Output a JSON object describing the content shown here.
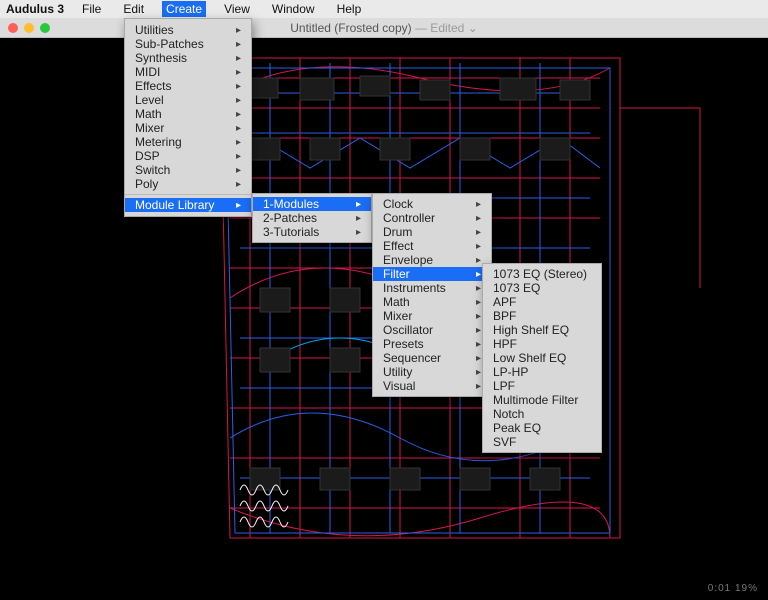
{
  "app_name": "Audulus 3",
  "menubar": [
    "File",
    "Edit",
    "Create",
    "View",
    "Window",
    "Help"
  ],
  "menubar_active": "Create",
  "window": {
    "title_main": "Untitled (Frosted copy)",
    "title_suffix": " — Edited",
    "title_caret": "⌄"
  },
  "status_text": "0:01    19%",
  "menu_create": {
    "items": [
      "Utilities",
      "Sub-Patches",
      "Synthesis",
      "MIDI",
      "Effects",
      "Level",
      "Math",
      "Mixer",
      "Metering",
      "DSP",
      "Switch",
      "Poly"
    ],
    "highlight": "Module Library"
  },
  "menu_module_library": {
    "items": [
      "1-Modules",
      "2-Patches",
      "3-Tutorials"
    ],
    "highlight_index": 0
  },
  "menu_modules": {
    "items": [
      "Clock",
      "Controller",
      "Drum",
      "Effect",
      "Envelope",
      "Filter",
      "Instruments",
      "Math",
      "Mixer",
      "Oscillator",
      "Presets",
      "Sequencer",
      "Utility",
      "Visual"
    ],
    "highlight": "Filter"
  },
  "menu_filter": {
    "items": [
      "1073 EQ (Stereo)",
      "1073 EQ",
      "APF",
      "BPF",
      "High Shelf EQ",
      "HPF",
      "Low Shelf EQ",
      "LP-HP",
      "LPF",
      "Multimode Filter",
      "Notch",
      "Peak EQ",
      "SVF"
    ]
  },
  "colors": {
    "wire_red": "#e81b5a",
    "wire_blue": "#2f6bff",
    "wire_cyan": "#00b3ff",
    "node": "#2a2a2a"
  }
}
